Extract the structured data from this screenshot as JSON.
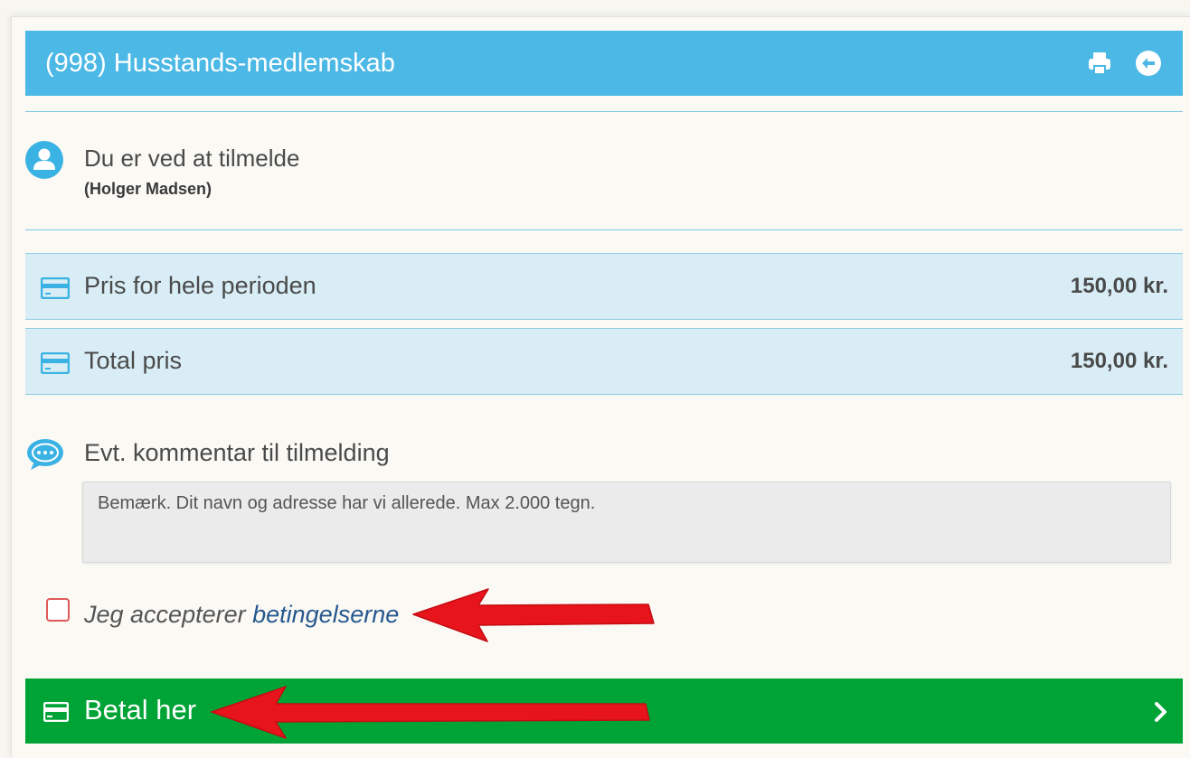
{
  "header": {
    "title": "(998) Husstands-medlemskab",
    "icons": [
      "print-icon",
      "back-circle-icon"
    ],
    "color": "#4cb8e5"
  },
  "registration": {
    "title": "Du er ved at tilmelde",
    "name": "(Holger Madsen)"
  },
  "prices": [
    {
      "label": "Pris for hele perioden",
      "value": "150,00 kr."
    },
    {
      "label": "Total pris",
      "value": "150,00 kr."
    }
  ],
  "comment": {
    "label": "Evt. kommentar til tilmelding",
    "placeholder": "Bemærk. Dit navn og adresse har vi allerede. Max 2.000 tegn.",
    "value": ""
  },
  "terms": {
    "checked": false,
    "prefix": "Jeg accepterer ",
    "link": "betingelserne"
  },
  "pay": {
    "label": "Betal her",
    "color": "#00a335"
  },
  "annotation_color": "#e8141b"
}
